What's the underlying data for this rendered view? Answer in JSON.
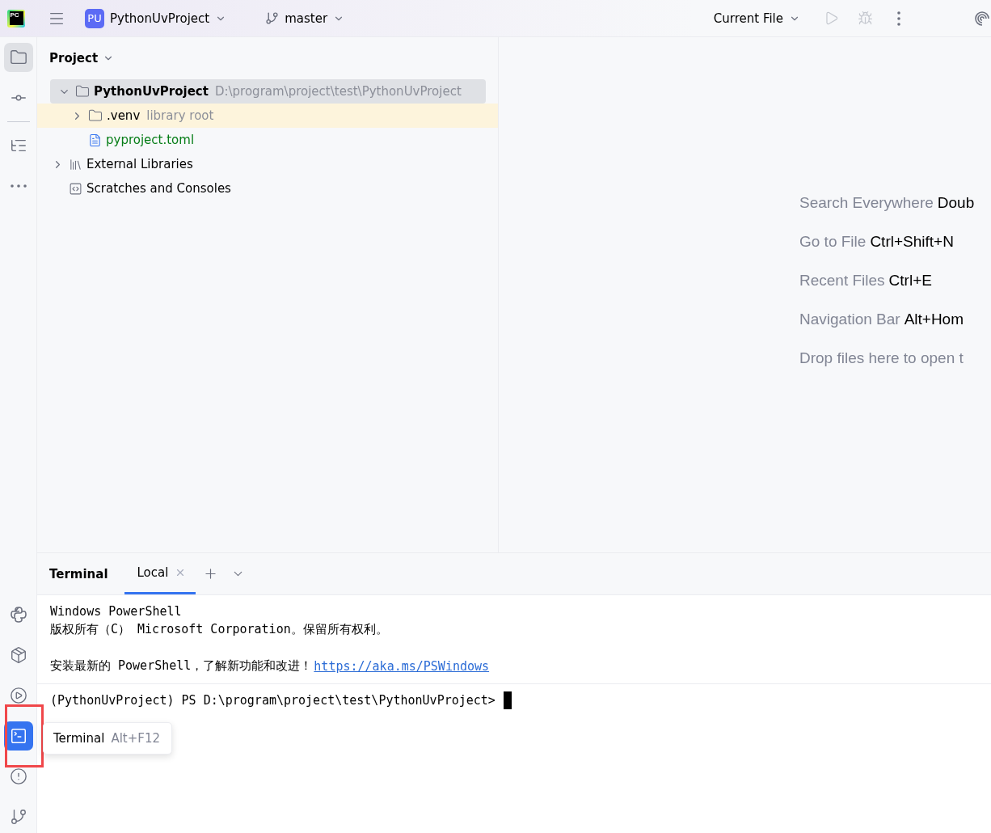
{
  "toolbar": {
    "logo_text": "PC",
    "project": {
      "badge": "PU",
      "name": "PythonUvProject"
    },
    "branch": "master",
    "run_config": "Current File"
  },
  "left_tools_top": [
    {
      "kind": "project",
      "selected": true
    },
    {
      "kind": "commit",
      "selected": false
    },
    {
      "kind": "structure",
      "selected": false
    },
    {
      "kind": "more",
      "selected": false
    }
  ],
  "left_tools_bottom": [
    {
      "kind": "python-console",
      "selected": false
    },
    {
      "kind": "packages",
      "selected": false
    },
    {
      "kind": "services",
      "selected": false
    },
    {
      "kind": "terminal",
      "selected": true,
      "annotated": true
    },
    {
      "kind": "problems",
      "selected": false
    },
    {
      "kind": "git",
      "selected": false
    }
  ],
  "tooltip": {
    "label": "Terminal",
    "shortcut": "Alt+F12"
  },
  "project_panel": {
    "title": "Project",
    "tree": [
      {
        "kind": "folder",
        "name": "PythonUvProject",
        "hint": "D:\\program\\project\\test\\PythonUvProject",
        "bold": true,
        "selected": true,
        "highlighted": false,
        "expanded": true,
        "children": [
          {
            "kind": "folder",
            "name": ".venv",
            "hint": "library root",
            "bold": false,
            "selected": false,
            "highlighted": true,
            "expanded": false
          },
          {
            "kind": "toml",
            "name": "pyproject.toml",
            "bold": false,
            "selected": false,
            "highlighted": false
          }
        ]
      },
      {
        "kind": "libraries",
        "name": "External Libraries",
        "bold": false,
        "selected": false,
        "highlighted": false,
        "expanded": false
      },
      {
        "kind": "scratches",
        "name": "Scratches and Consoles",
        "bold": false,
        "selected": false,
        "highlighted": false
      }
    ]
  },
  "editor_hints": [
    {
      "label": "Search Everywhere",
      "shortcut": "Doub"
    },
    {
      "label": "Go to File",
      "shortcut": "Ctrl+Shift+N"
    },
    {
      "label": "Recent Files",
      "shortcut": "Ctrl+E"
    },
    {
      "label": "Navigation Bar",
      "shortcut": "Alt+Hom"
    },
    {
      "label": "Drop files here to open t"
    }
  ],
  "terminal": {
    "title": "Terminal",
    "tabs": [
      {
        "label": "Local",
        "selected": true
      }
    ],
    "output_blocks": [
      [
        [
          {
            "kind": "text",
            "text": "Windows PowerShell"
          }
        ],
        [
          {
            "kind": "text",
            "text": "版权所有（C） Microsoft Corporation。保留所有权利。"
          }
        ]
      ],
      [
        [
          {
            "kind": "text",
            "text": "安装最新的 PowerShell，了解新功能和改进！"
          },
          {
            "kind": "link",
            "text": "https://aka.ms/PSWindows"
          }
        ]
      ]
    ],
    "prompt": "(PythonUvProject) PS D:\\program\\project\\test\\PythonUvProject>"
  }
}
